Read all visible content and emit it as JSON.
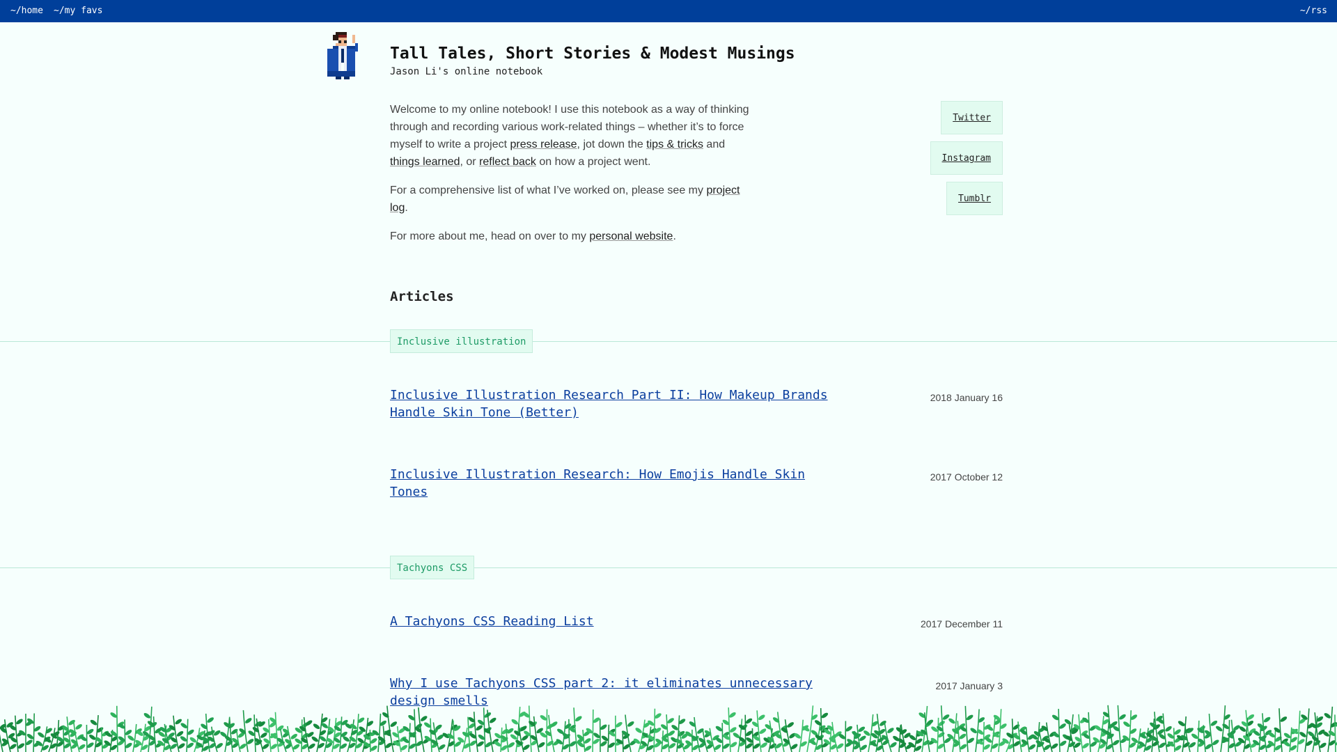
{
  "nav": {
    "home": "~/home",
    "favs": "~/my favs",
    "rss": "~/rss"
  },
  "header": {
    "title": "Tall Tales, Short Stories & Modest Musings",
    "subtitle": "Jason Li's online notebook"
  },
  "intro": {
    "p1_a": "Welcome to my online notebook! I use this notebook as a way of thinking through and recording various work-related things – whether it’s to force myself to write a project ",
    "press_release": "press release",
    "p1_b": ", jot down the ",
    "tips": "tips & tricks",
    "p1_c": " and ",
    "things_learned": "things learned",
    "p1_d": ", or ",
    "reflect_back": "reflect back",
    "p1_e": " on how a project went.",
    "p2_a": "For a comprehensive list of what I’ve worked on, please see my ",
    "project_log": "project log",
    "p2_b": ".",
    "p3_a": "For more about me, head on over to my ",
    "personal_website": "personal website",
    "p3_b": "."
  },
  "social": [
    "Twitter",
    "Instagram",
    "Tumblr"
  ],
  "articles": {
    "heading": "Articles",
    "sections": [
      {
        "tag": "Inclusive illustration",
        "items": [
          {
            "title": "Inclusive Illustration Research Part II: How Makeup Brands Handle Skin Tone (Better)",
            "date": "2018 January 16"
          },
          {
            "title": "Inclusive Illustration Research: How Emojis Handle Skin Tones",
            "date": "2017 October 12"
          }
        ]
      },
      {
        "tag": "Tachyons CSS",
        "items": [
          {
            "title": "A Tachyons CSS Reading List",
            "date": "2017 December 11"
          },
          {
            "title": "Why I use Tachyons CSS part 2: it eliminates unnecessary design smells",
            "date": "2017 January 3"
          }
        ]
      }
    ]
  },
  "colors": {
    "nav_bg": "#003f9a",
    "page_bg": "#f6fffd",
    "link": "#0b3e9e",
    "tag_text": "#1e9b66",
    "tag_bg": "#e2fbf0"
  },
  "icons": {
    "avatar": "pixel-art-person-avatar",
    "footer": "leaf-foliage-decoration"
  }
}
